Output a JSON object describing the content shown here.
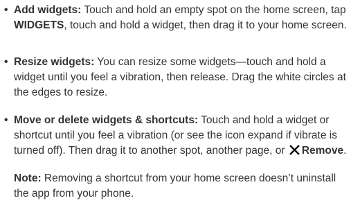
{
  "bullets": [
    {
      "marker": "•",
      "term": "Add widgets:",
      "text_a": " Touch and hold an empty spot on the home screen, tap ",
      "text_bold": "WIDGETS",
      "text_b": ", touch and hold a widget, then drag it to your home screen."
    },
    {
      "marker": "•",
      "term": "Resize widgets:",
      "text": " You can resize some widgets—touch and hold a widget until you feel a vibration, then release. Drag the white circles at the edges to resize."
    },
    {
      "marker": "•",
      "term": "Move or delete widgets & shortcuts:",
      "text_a": " Touch and hold a widget or shortcut until you feel a vibration (or see the icon expand if vibrate is turned off). Then drag it to another spot, another page, or ",
      "icon": "close-x-icon",
      "text_bold": "Remove",
      "text_b": "."
    }
  ],
  "note": {
    "label": "Note:",
    "text": " Removing a shortcut from your home screen doesn’t uninstall the app from your phone."
  }
}
